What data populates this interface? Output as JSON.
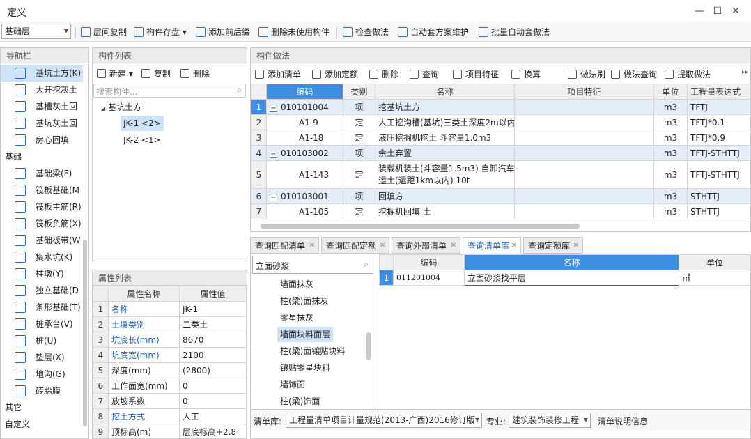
{
  "window": {
    "title": "定义"
  },
  "toolbar": {
    "floor": "基础层",
    "items": [
      {
        "label": "层间复制",
        "icon": "copy-floor-icon"
      },
      {
        "label": "构件存盘",
        "icon": "save-component-icon"
      },
      {
        "label": "添加前后缀",
        "icon": "add-affix-icon"
      },
      {
        "label": "删除未使用构件",
        "icon": "delete-unused-icon"
      },
      {
        "label": "检查做法",
        "icon": "check-method-icon"
      },
      {
        "label": "自动套方案维护",
        "icon": "auto-scheme-icon"
      },
      {
        "label": "批量自动套做法",
        "icon": "batch-auto-icon"
      }
    ]
  },
  "nav": {
    "title": "导航栏",
    "items_top": [
      {
        "label": "基坑土方(K)",
        "icon": "pit-icon"
      },
      {
        "label": "大开挖灰土",
        "icon": "excavation-icon"
      },
      {
        "label": "基槽灰土回",
        "icon": "trench-icon"
      },
      {
        "label": "基坑灰土回",
        "icon": "pit-backfill-icon"
      },
      {
        "label": "房心回填",
        "icon": "room-backfill-icon"
      }
    ],
    "group_foundation": "基础",
    "items_foundation": [
      {
        "label": "基础梁(F)",
        "icon": "beam-icon"
      },
      {
        "label": "筏板基础(M",
        "icon": "raft-icon"
      },
      {
        "label": "筏板主筋(R)",
        "icon": "raft-main-rebar-icon"
      },
      {
        "label": "筏板负筋(X)",
        "icon": "raft-neg-rebar-icon"
      },
      {
        "label": "基础板带(W",
        "icon": "strip-icon"
      },
      {
        "label": "集水坑(K)",
        "icon": "sump-icon"
      },
      {
        "label": "柱墩(Y)",
        "icon": "pier-icon"
      },
      {
        "label": "独立基础(D",
        "icon": "isolated-foundation-icon"
      },
      {
        "label": "条形基础(T)",
        "icon": "strip-foundation-icon"
      },
      {
        "label": "桩承台(V)",
        "icon": "pile-cap-icon"
      },
      {
        "label": "桩(U)",
        "icon": "pile-icon"
      },
      {
        "label": "垫层(X)",
        "icon": "cushion-icon"
      },
      {
        "label": "地沟(G)",
        "icon": "trench-g-icon"
      },
      {
        "label": "砖胎膜",
        "icon": "brick-mold-icon"
      }
    ],
    "group_other": "其它",
    "group_custom": "自定义"
  },
  "components": {
    "title": "构件列表",
    "new_label": "新建",
    "copy_label": "复制",
    "delete_label": "删除",
    "search_placeholder": "搜索构件...",
    "tree_root": "基坑土方",
    "tree_items": [
      "JK-1 <2>",
      "JK-2 <1>"
    ]
  },
  "props": {
    "title": "属性列表",
    "headers": [
      "属性名称",
      "属性值"
    ],
    "rows": [
      {
        "n": "1",
        "name": "名称",
        "value": "JK-1",
        "blue": true
      },
      {
        "n": "2",
        "name": "土壤类别",
        "value": "二类土",
        "blue": true
      },
      {
        "n": "3",
        "name": "坑底长(mm)",
        "value": "8670",
        "blue": true
      },
      {
        "n": "4",
        "name": "坑底宽(mm)",
        "value": "2100",
        "blue": true
      },
      {
        "n": "5",
        "name": "深度(mm)",
        "value": "(2800)",
        "blue": false
      },
      {
        "n": "6",
        "name": "工作面宽(mm)",
        "value": "0",
        "blue": false
      },
      {
        "n": "7",
        "name": "放坡系数",
        "value": "0",
        "blue": false
      },
      {
        "n": "8",
        "name": "挖土方式",
        "value": "人工",
        "blue": true
      },
      {
        "n": "9",
        "name": "顶标高(m)",
        "value": "层底标高+2.8",
        "blue": false
      }
    ]
  },
  "method": {
    "title": "构件做法",
    "toolbar": [
      {
        "label": "添加清单",
        "icon": "add-list-icon"
      },
      {
        "label": "添加定额",
        "icon": "add-quota-icon"
      },
      {
        "label": "删除",
        "icon": "delete-icon"
      },
      {
        "label": "查询",
        "icon": "query-icon"
      },
      {
        "label": "项目特征",
        "icon": "feature-icon"
      },
      {
        "label": "换算",
        "icon": "convert-icon"
      },
      {
        "label": "做法刷",
        "icon": "brush-icon"
      },
      {
        "label": "做法查询",
        "icon": "method-query-icon"
      },
      {
        "label": "提取做法",
        "icon": "extract-icon"
      }
    ],
    "headers": [
      "编码",
      "类别",
      "名称",
      "项目特征",
      "单位",
      "工程量表达式"
    ],
    "rows": [
      {
        "n": "1",
        "code": "010101004",
        "type": "项",
        "name": "挖基坑土方",
        "feature": "",
        "unit": "m3",
        "expr": "TFTJ",
        "parent": true
      },
      {
        "n": "2",
        "code": "A1-9",
        "type": "定",
        "name": "人工挖沟槽(基坑)三类土深度2m以内",
        "feature": "",
        "unit": "m3",
        "expr": "TFTJ*0.1",
        "parent": false
      },
      {
        "n": "3",
        "code": "A1-18",
        "type": "定",
        "name": "液压挖掘机挖土 斗容量1.0m3",
        "feature": "",
        "unit": "m3",
        "expr": "TFTJ*0.9",
        "parent": false
      },
      {
        "n": "4",
        "code": "010103002",
        "type": "项",
        "name": "余土弃置",
        "feature": "",
        "unit": "m3",
        "expr": "TFTJ-STHTTJ",
        "parent": true
      },
      {
        "n": "5",
        "code": "A1-143",
        "type": "定",
        "name": "装载机装土(斗容量1.5m3) 自卸汽车\n运土(运距1km以内) 10t",
        "feature": "",
        "unit": "m3",
        "expr": "TFTJ-STHTTJ",
        "parent": false
      },
      {
        "n": "6",
        "code": "010103001",
        "type": "项",
        "name": "回填方",
        "feature": "",
        "unit": "m3",
        "expr": "STHTTJ",
        "parent": true
      },
      {
        "n": "7",
        "code": "A1-105",
        "type": "定",
        "name": "挖掘机回填 土",
        "feature": "",
        "unit": "m3",
        "expr": "STHTTJ",
        "parent": false
      }
    ]
  },
  "query": {
    "tabs": [
      "查询匹配清单",
      "查询匹配定额",
      "查询外部清单",
      "查询清单库",
      "查询定额库"
    ],
    "active_tab": 3,
    "search_value": "立面砂浆",
    "lib_items": [
      "墙面抹灰",
      "柱(梁)面抹灰",
      "零星抹灰",
      "墙面块料面层",
      "柱(梁)面镶贴块料",
      "镶贴零星块料",
      "墙饰面",
      "柱(梁)饰面"
    ],
    "lib_selected": 3,
    "headers": [
      "编码",
      "名称",
      "单位"
    ],
    "rows": [
      {
        "n": "1",
        "code": "011201004",
        "name": "立面砂浆找平层",
        "unit": "㎡"
      }
    ],
    "footer": {
      "lib_label": "清单库:",
      "lib_value": "工程量清单项目计量规范(2013-广西)2016修订版",
      "major_label": "专业:",
      "major_value": "建筑装饰装修工程",
      "desc_label": "清单说明信息"
    }
  }
}
